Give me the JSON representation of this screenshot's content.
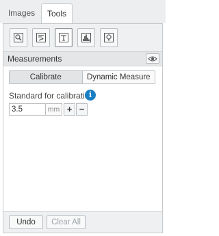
{
  "tabs": [
    {
      "label": "Images",
      "active": false
    },
    {
      "label": "Tools",
      "active": true
    }
  ],
  "toolbar": {
    "tools": [
      {
        "icon": "zoom-search-icon",
        "active": false
      },
      {
        "icon": "list-export-icon",
        "active": false
      },
      {
        "icon": "measure-icon",
        "active": true
      },
      {
        "icon": "histogram-icon",
        "active": false
      },
      {
        "icon": "lightbulb-icon",
        "active": false
      }
    ]
  },
  "section": {
    "title": "Measurements",
    "visibility_icon": "eye-icon"
  },
  "mode": {
    "options": [
      "Calibrate",
      "Dynamic Measure"
    ],
    "selected": "Calibrate"
  },
  "calibration": {
    "label": "Standard for calibration",
    "info_symbol": "i",
    "value": "3.5",
    "unit": "mm",
    "increment": "+",
    "decrement": "−"
  },
  "footer": {
    "undo_label": "Undo",
    "clear_label": "Clear All"
  },
  "colors": {
    "accent": "#1b7fc4"
  }
}
